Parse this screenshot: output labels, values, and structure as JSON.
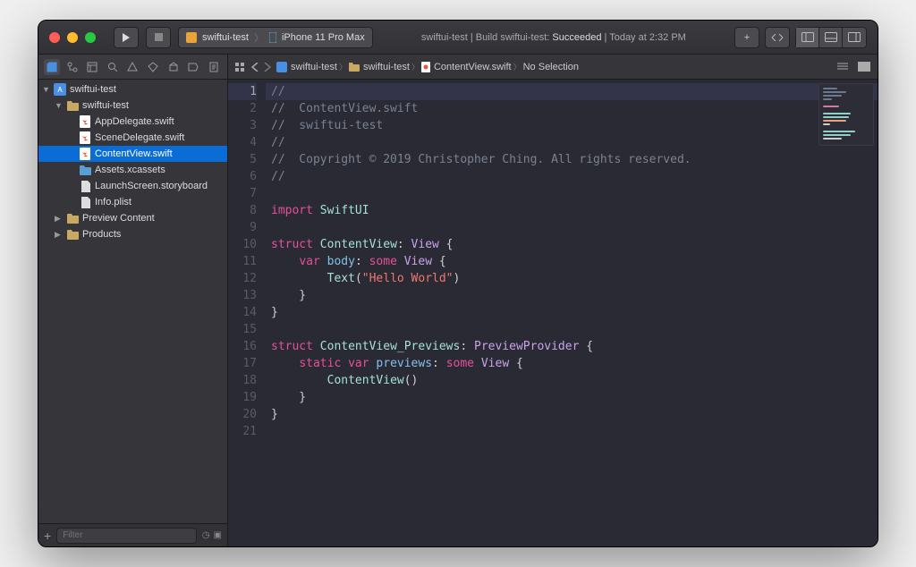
{
  "toolbar": {
    "scheme_target": "swiftui-test",
    "scheme_device": "iPhone 11 Pro Max",
    "status_prefix": "swiftui-test | Build swiftui-test: ",
    "status_result": "Succeeded",
    "status_time": " | Today at 2:32 PM"
  },
  "sidebar": {
    "filter_placeholder": "Filter",
    "tree": [
      {
        "label": "swiftui-test",
        "depth": 0,
        "kind": "proj",
        "expanded": true
      },
      {
        "label": "swiftui-test",
        "depth": 1,
        "kind": "folder",
        "expanded": true
      },
      {
        "label": "AppDelegate.swift",
        "depth": 2,
        "kind": "swift"
      },
      {
        "label": "SceneDelegate.swift",
        "depth": 2,
        "kind": "swift"
      },
      {
        "label": "ContentView.swift",
        "depth": 2,
        "kind": "swift",
        "selected": true
      },
      {
        "label": "Assets.xcassets",
        "depth": 2,
        "kind": "folder-blue"
      },
      {
        "label": "LaunchScreen.storyboard",
        "depth": 2,
        "kind": "file"
      },
      {
        "label": "Info.plist",
        "depth": 2,
        "kind": "file"
      },
      {
        "label": "Preview Content",
        "depth": 1,
        "kind": "folder",
        "expanded": false,
        "expandable": true
      },
      {
        "label": "Products",
        "depth": 1,
        "kind": "folder",
        "expanded": false,
        "expandable": true
      }
    ]
  },
  "jumpbar": {
    "items": [
      "swiftui-test",
      "swiftui-test",
      "ContentView.swift",
      "No Selection"
    ]
  },
  "code": {
    "current_line": 1,
    "lines": [
      {
        "n": 1,
        "tokens": [
          [
            "c-cmt",
            "//"
          ]
        ]
      },
      {
        "n": 2,
        "tokens": [
          [
            "c-cmt",
            "//  ContentView.swift"
          ]
        ]
      },
      {
        "n": 3,
        "tokens": [
          [
            "c-cmt",
            "//  swiftui-test"
          ]
        ]
      },
      {
        "n": 4,
        "tokens": [
          [
            "c-cmt",
            "//"
          ]
        ]
      },
      {
        "n": 5,
        "tokens": [
          [
            "c-cmt",
            "//  Copyright © 2019 Christopher Ching. All rights reserved."
          ]
        ]
      },
      {
        "n": 6,
        "tokens": [
          [
            "c-cmt",
            "//"
          ]
        ]
      },
      {
        "n": 7,
        "tokens": []
      },
      {
        "n": 8,
        "tokens": [
          [
            "c-kw",
            "import"
          ],
          [
            "",
            " "
          ],
          [
            "c-type",
            "SwiftUI"
          ]
        ]
      },
      {
        "n": 9,
        "tokens": []
      },
      {
        "n": 10,
        "tokens": [
          [
            "c-kw",
            "struct"
          ],
          [
            "",
            " "
          ],
          [
            "c-type",
            "ContentView"
          ],
          [
            "",
            ": "
          ],
          [
            "c-lib",
            "View"
          ],
          [
            "",
            " {"
          ]
        ]
      },
      {
        "n": 11,
        "tokens": [
          [
            "",
            "    "
          ],
          [
            "c-kw",
            "var"
          ],
          [
            "",
            " "
          ],
          [
            "c-id",
            "body"
          ],
          [
            "",
            ": "
          ],
          [
            "c-kw",
            "some"
          ],
          [
            "",
            " "
          ],
          [
            "c-lib",
            "View"
          ],
          [
            "",
            " {"
          ]
        ]
      },
      {
        "n": 12,
        "tokens": [
          [
            "",
            "        "
          ],
          [
            "c-type",
            "Text"
          ],
          [
            "",
            "("
          ],
          [
            "c-str",
            "\"Hello World\""
          ],
          [
            "",
            ")"
          ]
        ]
      },
      {
        "n": 13,
        "tokens": [
          [
            "",
            "    }"
          ]
        ]
      },
      {
        "n": 14,
        "tokens": [
          [
            "",
            "}"
          ]
        ]
      },
      {
        "n": 15,
        "tokens": []
      },
      {
        "n": 16,
        "tokens": [
          [
            "c-kw",
            "struct"
          ],
          [
            "",
            " "
          ],
          [
            "c-type",
            "ContentView_Previews"
          ],
          [
            "",
            ": "
          ],
          [
            "c-lib",
            "PreviewProvider"
          ],
          [
            "",
            " {"
          ]
        ]
      },
      {
        "n": 17,
        "tokens": [
          [
            "",
            "    "
          ],
          [
            "c-kw",
            "static"
          ],
          [
            "",
            " "
          ],
          [
            "c-kw",
            "var"
          ],
          [
            "",
            " "
          ],
          [
            "c-id",
            "previews"
          ],
          [
            "",
            ": "
          ],
          [
            "c-kw",
            "some"
          ],
          [
            "",
            " "
          ],
          [
            "c-lib",
            "View"
          ],
          [
            "",
            " {"
          ]
        ]
      },
      {
        "n": 18,
        "tokens": [
          [
            "",
            "        "
          ],
          [
            "c-type",
            "ContentView"
          ],
          [
            "",
            "()"
          ]
        ]
      },
      {
        "n": 19,
        "tokens": [
          [
            "",
            "    }"
          ]
        ]
      },
      {
        "n": 20,
        "tokens": [
          [
            "",
            "}"
          ]
        ]
      },
      {
        "n": 21,
        "tokens": []
      }
    ]
  }
}
